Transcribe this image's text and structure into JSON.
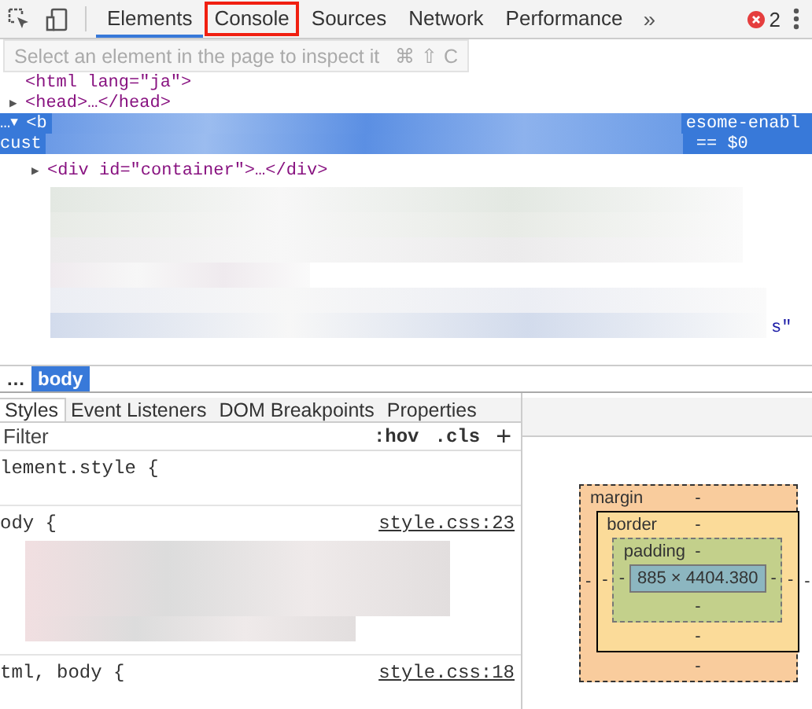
{
  "toolbar": {
    "tabs": [
      {
        "label": "Elements",
        "selected": true,
        "highlighted": false
      },
      {
        "label": "Console",
        "selected": false,
        "highlighted": true
      },
      {
        "label": "Sources",
        "selected": false,
        "highlighted": false
      },
      {
        "label": "Network",
        "selected": false,
        "highlighted": false
      },
      {
        "label": "Performance",
        "selected": false,
        "highlighted": false
      }
    ],
    "more": "»",
    "error_count": "2"
  },
  "tooltip": {
    "text": "Select an element in the page to inspect it",
    "shortcut": "⌘ ⇧ C"
  },
  "dom_tree": {
    "lines": [
      {
        "kind": "plain",
        "text": "<html lang=\"ja\">"
      },
      {
        "kind": "plain",
        "arrow": "▶",
        "text": "<head>…</head>"
      },
      {
        "kind": "selected",
        "lead": "…",
        "arrow": "▼",
        "text": "<b",
        "tail": "esome-enabl"
      },
      {
        "kind": "selected",
        "text": "cust",
        "tail": "== $0"
      },
      {
        "kind": "child",
        "arrow": "▶",
        "text": "<div id=\"container\">…</div>"
      },
      {
        "kind": "blurred",
        "text": "s\""
      }
    ]
  },
  "breadcrumb": [
    {
      "label": "…",
      "selected": false
    },
    {
      "label": "body",
      "selected": true
    }
  ],
  "subtabs": [
    {
      "label": "Styles",
      "selected": true
    },
    {
      "label": "Event Listeners",
      "selected": false
    },
    {
      "label": "DOM Breakpoints",
      "selected": false
    },
    {
      "label": "Properties",
      "selected": false
    }
  ],
  "filter": {
    "placeholder": "Filter",
    "hov": ":hov",
    "cls": ".cls",
    "add": "+"
  },
  "rules": [
    {
      "selector": "lement.style {",
      "blurred": false
    },
    {
      "selector": "ody {",
      "source": "style.css:23",
      "blurred": true
    },
    {
      "selector": "tml, body {",
      "source": "style.css:18",
      "blurred": false
    }
  ],
  "box_model": {
    "layers": [
      {
        "label": "margin",
        "top": "-",
        "left": "-",
        "right": "-"
      },
      {
        "label": "border",
        "top": "-",
        "left": "-",
        "right": "-"
      },
      {
        "label": "padding",
        "top": "-",
        "left": "-",
        "right": "-"
      }
    ],
    "content": "885 × 4404.380",
    "bottom_values": [
      "-",
      "-",
      "-"
    ]
  }
}
